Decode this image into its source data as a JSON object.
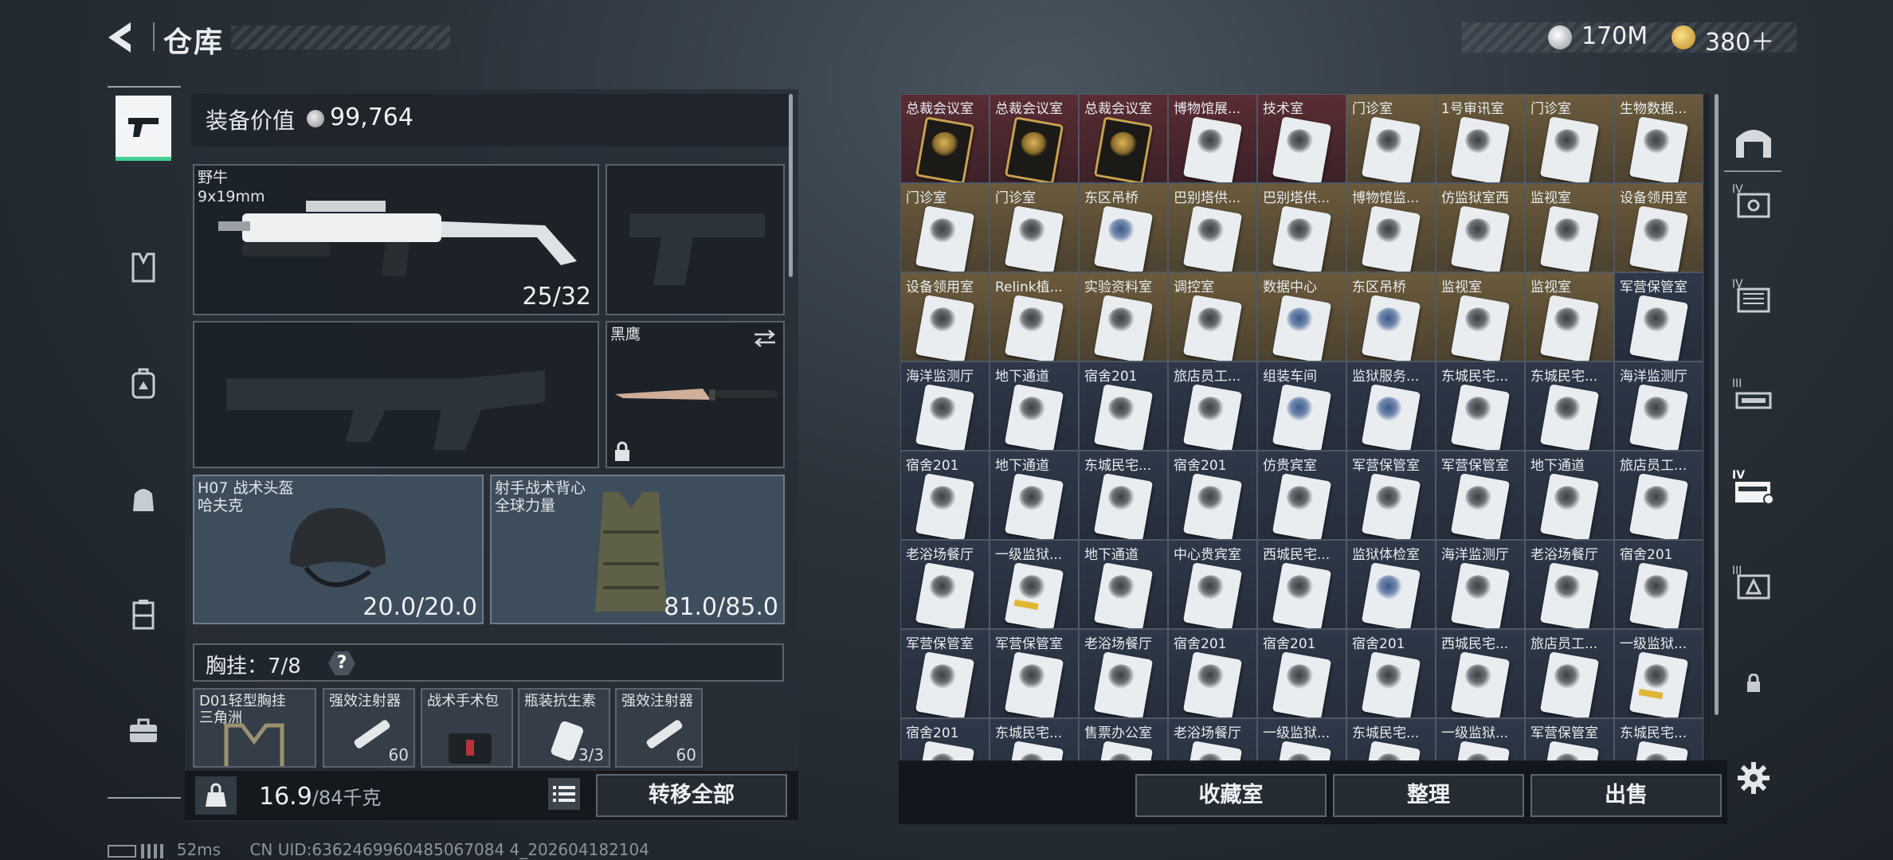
{
  "header": {
    "title": "仓库",
    "currency_silver": "170M",
    "currency_gold": "380＋"
  },
  "equipment": {
    "value_label": "装备价值",
    "value": "99,764",
    "primary_weapon": {
      "name": "野牛",
      "ammo_type": "9x19mm",
      "ammo_count": "25/32"
    },
    "melee": {
      "name": "黑鹰"
    },
    "helmet": {
      "name": "H07 战术头盔",
      "brand": "哈夫克",
      "durability": "20.0/20.0"
    },
    "armor": {
      "name": "射手战术背心",
      "brand": "全球力量",
      "durability": "81.0/85.0"
    },
    "rig": {
      "label": "胸挂：7/8",
      "help": "?"
    },
    "rig_items": [
      {
        "label": "D01轻型胸挂",
        "sub": "三角洲",
        "count": ""
      },
      {
        "label": "强效注射器",
        "sub": "",
        "count": "60"
      },
      {
        "label": "战术手术包",
        "sub": "",
        "count": ""
      },
      {
        "label": "瓶装抗生素",
        "sub": "",
        "count": "3/3"
      },
      {
        "label": "强效注射器",
        "sub": "",
        "count": "60"
      }
    ],
    "weight": "16.9",
    "weight_max": "/84千克",
    "transfer_all": "转移全部"
  },
  "stash": {
    "cells": [
      {
        "label": "总裁会议室",
        "style": "red",
        "card": "gold"
      },
      {
        "label": "总裁会议室",
        "style": "red",
        "card": "gold"
      },
      {
        "label": "总裁会议室",
        "style": "red",
        "card": "gold"
      },
      {
        "label": "博物馆展...",
        "style": "red",
        "card": "white"
      },
      {
        "label": "技术室",
        "style": "red",
        "card": "white"
      },
      {
        "label": "门诊室",
        "style": "gold",
        "card": "white"
      },
      {
        "label": "1号审讯室",
        "style": "gold",
        "card": "white"
      },
      {
        "label": "门诊室",
        "style": "gold",
        "card": "white"
      },
      {
        "label": "生物数据...",
        "style": "gold",
        "card": "white"
      },
      {
        "label": "门诊室",
        "style": "gold",
        "card": "white"
      },
      {
        "label": "门诊室",
        "style": "gold",
        "card": "white"
      },
      {
        "label": "东区吊桥",
        "style": "gold",
        "card": "blue"
      },
      {
        "label": "巴别塔供...",
        "style": "gold",
        "card": "white"
      },
      {
        "label": "巴别塔供...",
        "style": "gold",
        "card": "white"
      },
      {
        "label": "博物馆监...",
        "style": "gold",
        "card": "white"
      },
      {
        "label": "仿监狱室西",
        "style": "gold",
        "card": "white"
      },
      {
        "label": "监视室",
        "style": "gold",
        "card": "white"
      },
      {
        "label": "设备领用室",
        "style": "gold",
        "card": "white"
      },
      {
        "label": "设备领用室",
        "style": "gold",
        "card": "white"
      },
      {
        "label": "Relink植...",
        "style": "gold",
        "card": "white"
      },
      {
        "label": "实验资料室",
        "style": "gold",
        "card": "white"
      },
      {
        "label": "调控室",
        "style": "gold",
        "card": "white"
      },
      {
        "label": "数据中心",
        "style": "gold",
        "card": "blue"
      },
      {
        "label": "东区吊桥",
        "style": "gold",
        "card": "blue"
      },
      {
        "label": "监视室",
        "style": "gold",
        "card": "white"
      },
      {
        "label": "监视室",
        "style": "gold",
        "card": "white"
      },
      {
        "label": "军营保管室",
        "style": "plain",
        "card": "white"
      },
      {
        "label": "海洋监测厅",
        "style": "plain",
        "card": "white"
      },
      {
        "label": "地下通道",
        "style": "plain",
        "card": "white"
      },
      {
        "label": "宿舍201",
        "style": "plain",
        "card": "white"
      },
      {
        "label": "旅店员工...",
        "style": "plain",
        "card": "white"
      },
      {
        "label": "组装车间",
        "style": "plain",
        "card": "blue"
      },
      {
        "label": "监狱服务...",
        "style": "plain",
        "card": "blue"
      },
      {
        "label": "东城民宅...",
        "style": "plain",
        "card": "white"
      },
      {
        "label": "东城民宅...",
        "style": "plain",
        "card": "white"
      },
      {
        "label": "海洋监测厅",
        "style": "plain",
        "card": "white"
      },
      {
        "label": "宿舍201",
        "style": "plain",
        "card": "white"
      },
      {
        "label": "地下通道",
        "style": "plain",
        "card": "white"
      },
      {
        "label": "东城民宅...",
        "style": "plain",
        "card": "white"
      },
      {
        "label": "宿舍201",
        "style": "plain",
        "card": "white"
      },
      {
        "label": "仿贵宾室",
        "style": "plain",
        "card": "white"
      },
      {
        "label": "军营保管室",
        "style": "plain",
        "card": "white"
      },
      {
        "label": "军营保管室",
        "style": "plain",
        "card": "white"
      },
      {
        "label": "地下通道",
        "style": "plain",
        "card": "white"
      },
      {
        "label": "旅店员工...",
        "style": "plain",
        "card": "white"
      },
      {
        "label": "老浴场餐厅",
        "style": "plain",
        "card": "white"
      },
      {
        "label": "一级监狱...",
        "style": "plain",
        "card": "yellow"
      },
      {
        "label": "地下通道",
        "style": "plain",
        "card": "white"
      },
      {
        "label": "中心贵宾室",
        "style": "plain",
        "card": "white"
      },
      {
        "label": "西城民宅...",
        "style": "plain",
        "card": "white"
      },
      {
        "label": "监狱体检室",
        "style": "plain",
        "card": "blue"
      },
      {
        "label": "海洋监测厅",
        "style": "plain",
        "card": "white"
      },
      {
        "label": "老浴场餐厅",
        "style": "plain",
        "card": "white"
      },
      {
        "label": "宿舍201",
        "style": "plain",
        "card": "white"
      },
      {
        "label": "军营保管室",
        "style": "plain",
        "card": "white"
      },
      {
        "label": "军营保管室",
        "style": "plain",
        "card": "white"
      },
      {
        "label": "老浴场餐厅",
        "style": "plain",
        "card": "white"
      },
      {
        "label": "宿舍201",
        "style": "plain",
        "card": "white"
      },
      {
        "label": "宿舍201",
        "style": "plain",
        "card": "white"
      },
      {
        "label": "宿舍201",
        "style": "plain",
        "card": "white"
      },
      {
        "label": "西城民宅...",
        "style": "plain",
        "card": "white"
      },
      {
        "label": "旅店员工...",
        "style": "plain",
        "card": "white"
      },
      {
        "label": "一级监狱...",
        "style": "plain",
        "card": "yellow"
      },
      {
        "label": "宿舍201",
        "style": "plain",
        "card": "white"
      },
      {
        "label": "东城民宅...",
        "style": "plain",
        "card": "yellow"
      },
      {
        "label": "售票办公室",
        "style": "plain",
        "card": "yellow"
      },
      {
        "label": "老浴场餐厅",
        "style": "plain",
        "card": "white"
      },
      {
        "label": "一级监狱...",
        "style": "plain",
        "card": "yellow"
      },
      {
        "label": "东城民宅...",
        "style": "plain",
        "card": "yellow"
      },
      {
        "label": "一级监狱...",
        "style": "plain",
        "card": "yellow"
      },
      {
        "label": "军营保管室",
        "style": "plain",
        "card": "white"
      },
      {
        "label": "东城民宅...",
        "style": "plain",
        "card": "white"
      }
    ],
    "buttons": {
      "collection": "收藏室",
      "sort": "整理",
      "sell": "出售"
    }
  },
  "right_tabs": [
    "IV",
    "IV",
    "III",
    "IV",
    "III"
  ],
  "footer": {
    "ping": "52ms",
    "uid": "CN UID:6362469960485067084 4_202604182104"
  }
}
